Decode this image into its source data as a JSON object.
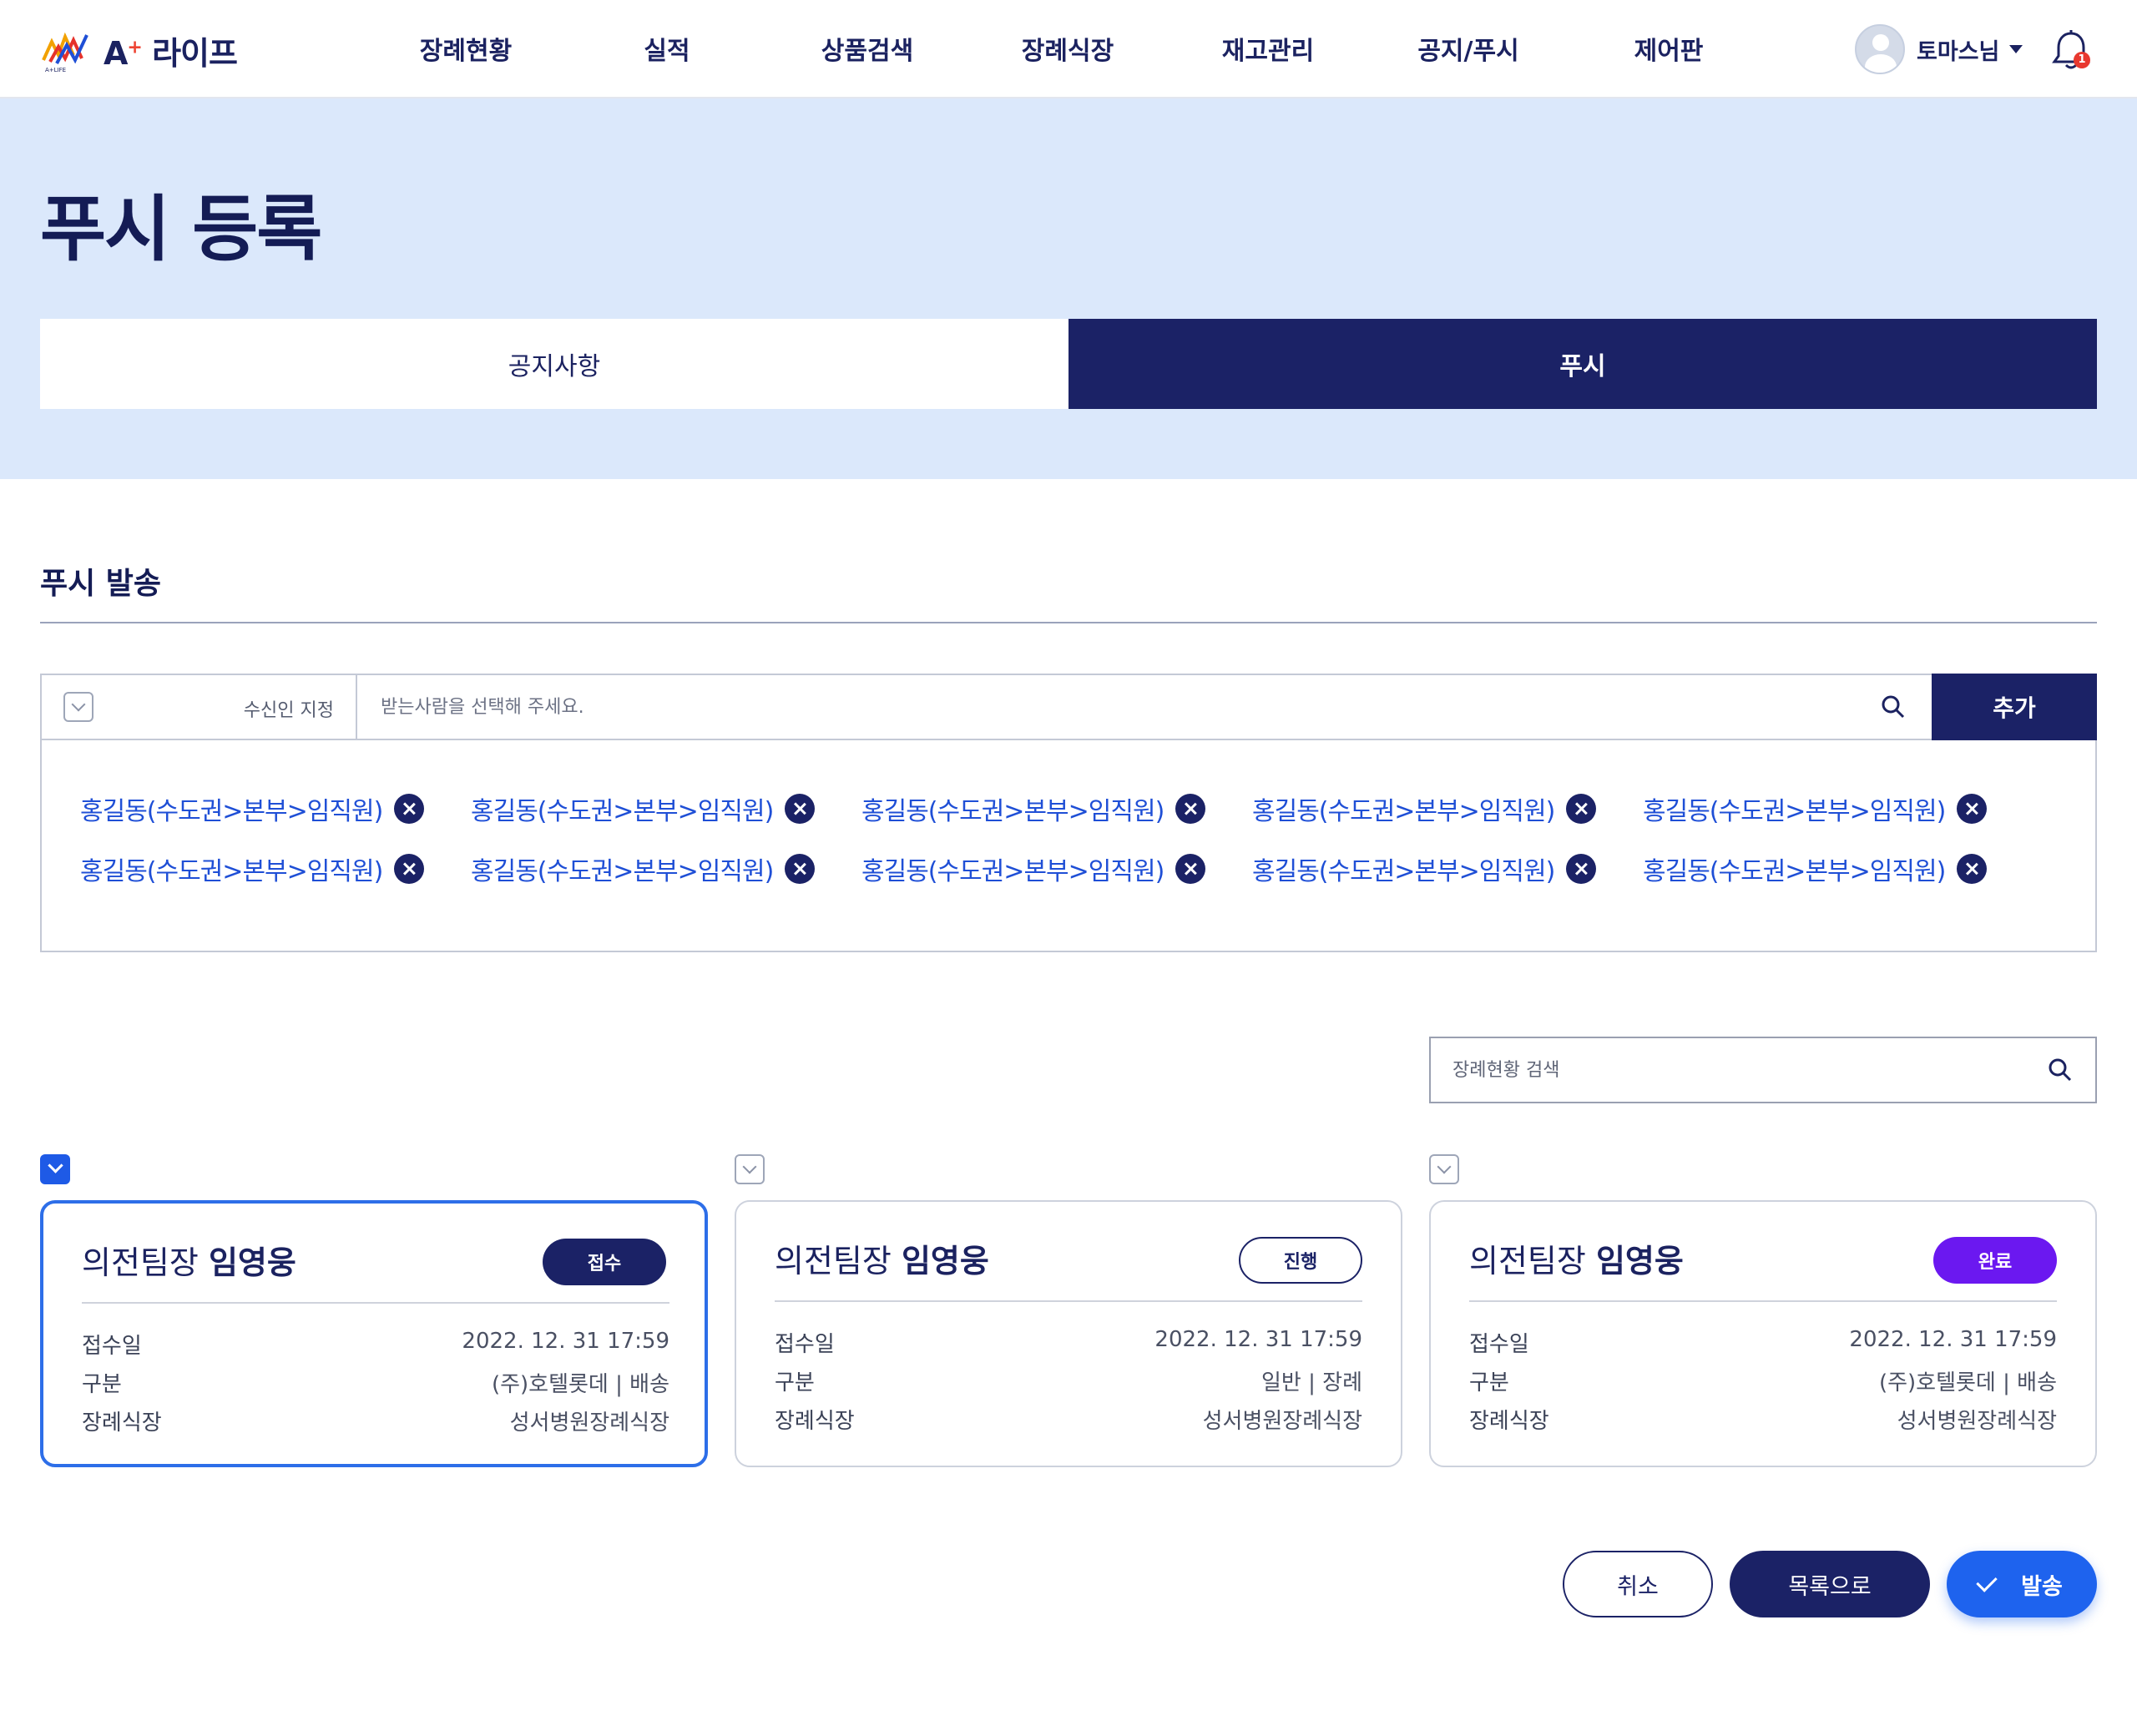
{
  "header": {
    "brand": "A",
    "brand_sup": "+",
    "brand_text": "라이프",
    "logo_sub": "A+LIFE",
    "nav": [
      "장례현황",
      "실적",
      "상품검색",
      "장례식장",
      "재고관리",
      "공지/푸시",
      "제어판"
    ],
    "user_name": "토마스님",
    "notification_count": "1"
  },
  "page": {
    "title": "푸시 등록",
    "tabs": {
      "notice": "공지사항",
      "push": "푸시"
    },
    "active_tab": "push"
  },
  "section": {
    "title": "푸시 발송"
  },
  "recipient": {
    "select_label": "수신인 지정",
    "placeholder": "받는사람을 선택해 주세요.",
    "add_label": "추가",
    "chips": [
      "홍길동(수도권>본부>임직원)",
      "홍길동(수도권>본부>임직원)",
      "홍길동(수도권>본부>임직원)",
      "홍길동(수도권>본부>임직원)",
      "홍길동(수도권>본부>임직원)",
      "홍길동(수도권>본부>임직원)",
      "홍길동(수도권>본부>임직원)",
      "홍길동(수도권>본부>임직원)",
      "홍길동(수도권>본부>임직원)",
      "홍길동(수도권>본부>임직원)"
    ]
  },
  "funeral_search": {
    "placeholder": "장례현황 검색"
  },
  "cards": [
    {
      "role": "의전팀장",
      "name": "임영웅",
      "status": "접수",
      "status_type": "received",
      "checked": true,
      "rows": [
        {
          "k": "접수일",
          "v": "2022. 12. 31 17:59"
        },
        {
          "k": "구분",
          "v": "(주)호텔롯데 | 배송"
        },
        {
          "k": "장례식장",
          "v": "성서병원장례식장"
        }
      ]
    },
    {
      "role": "의전팀장",
      "name": "임영웅",
      "status": "진행",
      "status_type": "progress",
      "checked": false,
      "rows": [
        {
          "k": "접수일",
          "v": "2022. 12. 31 17:59"
        },
        {
          "k": "구분",
          "v": "일반 | 장례"
        },
        {
          "k": "장례식장",
          "v": "성서병원장례식장"
        }
      ]
    },
    {
      "role": "의전팀장",
      "name": "임영웅",
      "status": "완료",
      "status_type": "done",
      "checked": false,
      "rows": [
        {
          "k": "접수일",
          "v": "2022. 12. 31 17:59"
        },
        {
          "k": "구분",
          "v": "(주)호텔롯데 | 배송"
        },
        {
          "k": "장례식장",
          "v": "성서병원장례식장"
        }
      ]
    }
  ],
  "actions": {
    "cancel": "취소",
    "list": "목록으로",
    "send": "발송"
  },
  "colors": {
    "navy": "#1b2266",
    "hero_bg": "#dbe8fb",
    "accent_blue": "#1e63ee",
    "chip_text": "#1f4fd6",
    "done_purple": "#6b18f0"
  },
  "icons": {
    "search": "search-icon",
    "bell": "bell-icon",
    "check": "check-icon",
    "remove": "close-circle-icon"
  }
}
